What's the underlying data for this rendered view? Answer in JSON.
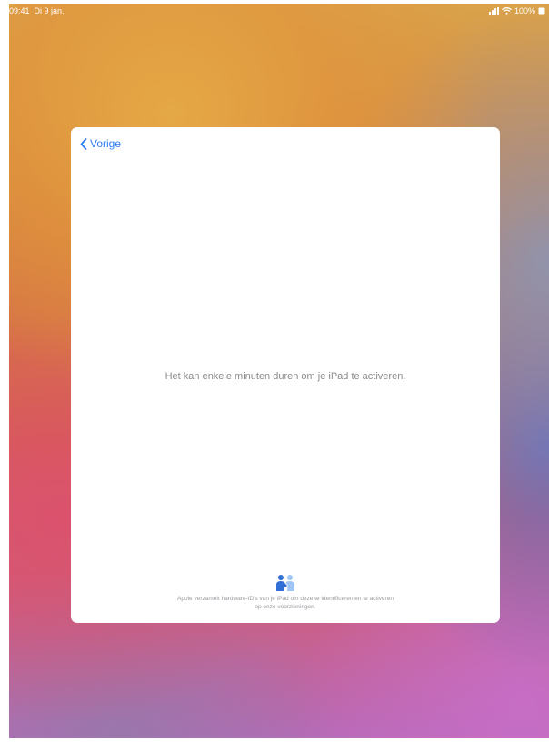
{
  "status_bar": {
    "time": "09:41",
    "date": "Di 9 jan.",
    "battery": "100%"
  },
  "sheet": {
    "back_label": "Vorige",
    "message": "Het kan enkele minuten duren om je iPad te activeren.",
    "privacy_icon": "privacy-handshake-icon",
    "privacy_text_line1": "Apple verzamelt hardware-ID's van je iPad om deze te identificeren en te activeren",
    "privacy_text_line2": "op onze voorzieningen."
  },
  "colors": {
    "accent": "#2f7cf6",
    "privacy_icon_dark": "#2f6fd6",
    "privacy_icon_light": "#9ec5f5"
  }
}
